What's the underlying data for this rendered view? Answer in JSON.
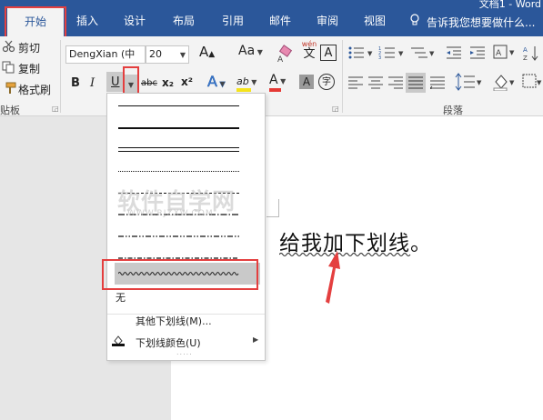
{
  "title_fragment": "文档1 - Word",
  "tabs": [
    "开始",
    "插入",
    "设计",
    "布局",
    "引用",
    "邮件",
    "审阅",
    "视图"
  ],
  "tell_me": "告诉我您想要做什么...",
  "clipboard": {
    "cut": "剪切",
    "copy": "复制",
    "format_painter": "格式刷",
    "group_label": "贴板"
  },
  "font": {
    "name": "DengXian (中",
    "size": "20",
    "bold": "B",
    "italic": "I",
    "underline": "U",
    "strikethrough": "abc",
    "subscript": "x₂",
    "superscript": "x²",
    "grow": "A",
    "change_case": "Aa",
    "phonetic_top": "wén",
    "phonetic_bottom": "文",
    "char_border": "A",
    "text_effects": "A",
    "font_color": "A",
    "char_shading": "A",
    "enclose_char": "字",
    "highlight": "ab"
  },
  "paragraph": {
    "group_label": "段落"
  },
  "document": {
    "text": "给我加下划线。"
  },
  "underline_menu": {
    "none": "无",
    "more": "其他下划线(M)...",
    "color": "下划线颜色(U)",
    "more_dots": "....."
  },
  "watermark": {
    "main": "软件自学网",
    "sub": "WWW.RJZXW.COM"
  },
  "colors": {
    "ribbon_blue": "#2b579a",
    "annotation_red": "#e43f3f",
    "font_color_red": "#e53935",
    "highlight_yellow": "#f5e31a"
  }
}
